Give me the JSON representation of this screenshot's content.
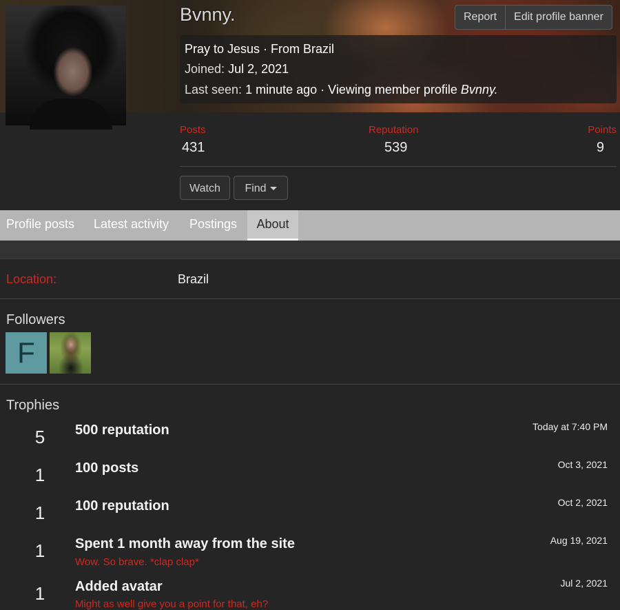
{
  "profile": {
    "username": "Bvnny.",
    "actions": {
      "report": "Report",
      "edit_banner": "Edit profile banner"
    },
    "blurb": {
      "custom_title": "Pray to Jesus",
      "separator": " · ",
      "from": "From Brazil",
      "joined_label": "Joined:",
      "joined_value": "Jul 2, 2021",
      "last_seen_label": "Last seen:",
      "last_seen_value": "1 minute ago · Viewing member profile",
      "last_seen_target": "Bvnny."
    },
    "stats": {
      "posts_label": "Posts",
      "posts_value": "431",
      "reputation_label": "Reputation",
      "reputation_value": "539",
      "points_label": "Points",
      "points_value": "9"
    },
    "buttons": {
      "watch": "Watch",
      "find": "Find"
    }
  },
  "tabs": [
    "Profile posts",
    "Latest activity",
    "Postings",
    "About"
  ],
  "active_tab": "About",
  "about": {
    "location_label": "Location:",
    "location_value": "Brazil",
    "followers_title": "Followers",
    "followers": [
      {
        "type": "letter-avatar",
        "letter": "F",
        "color": "#5f9aa0"
      },
      {
        "type": "photo-avatar"
      }
    ],
    "trophies_title": "Trophies",
    "trophies": [
      {
        "points": "5",
        "title": "500 reputation",
        "desc": "",
        "date": "Today at 7:40 PM"
      },
      {
        "points": "1",
        "title": "100 posts",
        "desc": "",
        "date": "Oct 3, 2021"
      },
      {
        "points": "1",
        "title": "100 reputation",
        "desc": "",
        "date": "Oct 2, 2021"
      },
      {
        "points": "1",
        "title": "Spent 1 month away from the site",
        "desc": "Wow. So brave. *clap clap*",
        "date": "Aug 19, 2021"
      },
      {
        "points": "1",
        "title": "Added avatar",
        "desc": "Might as well give you a point for that, eh?",
        "date": "Jul 2, 2021"
      }
    ]
  },
  "colors": {
    "accent_red": "#d0281f",
    "background": "#252526",
    "tab_bar": "#b5b5b5"
  }
}
